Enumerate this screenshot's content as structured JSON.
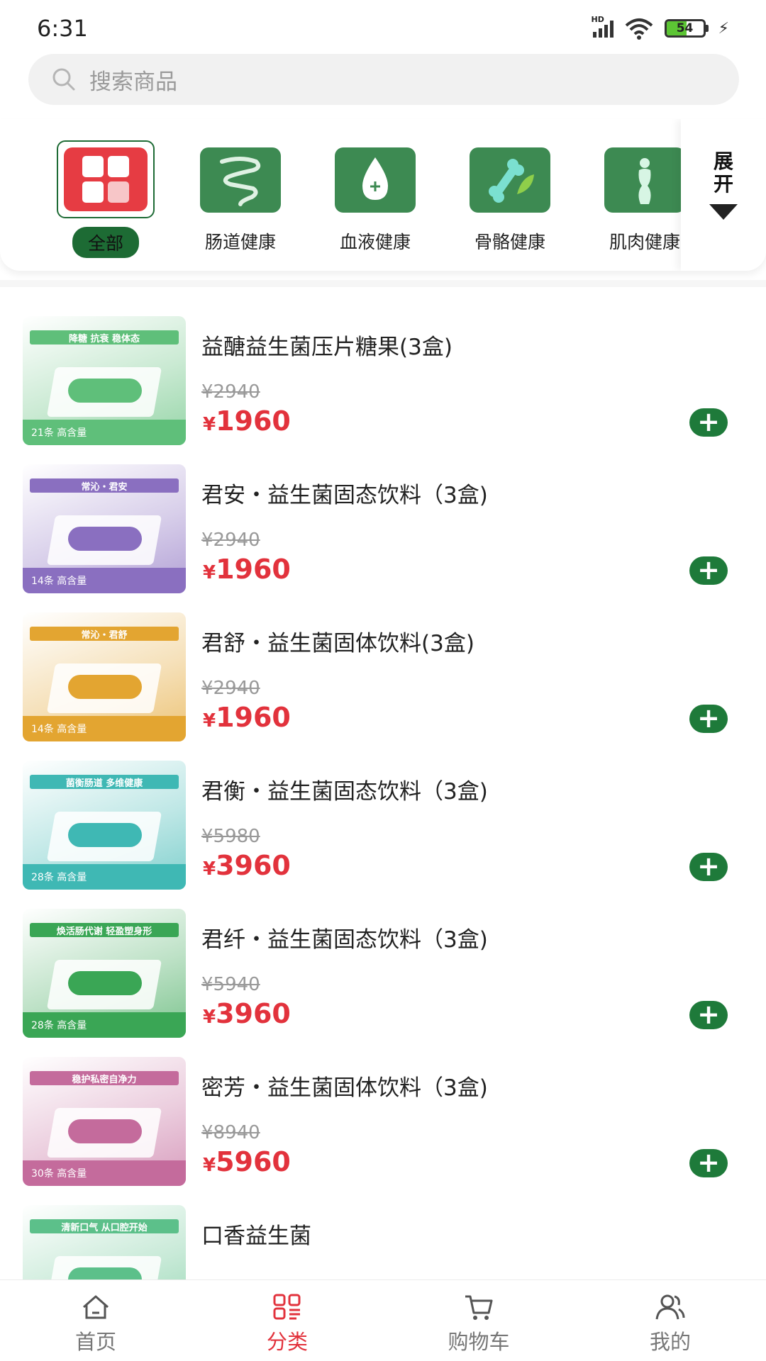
{
  "status_bar": {
    "time": "6:31",
    "network": "HD",
    "battery": "54",
    "battery_level": 0.54
  },
  "search": {
    "placeholder": "搜索商品"
  },
  "categories": {
    "items": [
      {
        "label": "全部",
        "icon": "grid-icon",
        "selected": true
      },
      {
        "label": "肠道健康",
        "icon": "intestine-icon"
      },
      {
        "label": "血液健康",
        "icon": "blood-drop-icon"
      },
      {
        "label": "骨骼健康",
        "icon": "bone-icon"
      },
      {
        "label": "肌肉健康",
        "icon": "body-icon"
      }
    ],
    "expand_label": "展开"
  },
  "products": [
    {
      "name": "益醣益生菌压片糖果(3盒)",
      "old_price": "2940",
      "price": "1960",
      "currency": "¥",
      "thumb": {
        "banner": "降糖 抗衰 稳体态",
        "badge": "21条 高含量",
        "theme": "#5fbf7a"
      }
    },
    {
      "name": "君安・益生菌固态饮料（3盒)",
      "old_price": "2940",
      "price": "1960",
      "currency": "¥",
      "thumb": {
        "banner": "常沁・君安",
        "badge": "14条 高含量",
        "theme": "#8a6fc0"
      }
    },
    {
      "name": "君舒・益生菌固体饮料(3盒)",
      "old_price": "2940",
      "price": "1960",
      "currency": "¥",
      "thumb": {
        "banner": "常沁・君舒",
        "badge": "14条 高含量",
        "theme": "#e3a531"
      }
    },
    {
      "name": "君衡・益生菌固态饮料（3盒)",
      "old_price": "5980",
      "price": "3960",
      "currency": "¥",
      "thumb": {
        "banner": "菌衡肠道 多维健康",
        "badge": "28条 高含量",
        "theme": "#3fb8b4"
      }
    },
    {
      "name": "君纤・益生菌固态饮料（3盒)",
      "old_price": "5940",
      "price": "3960",
      "currency": "¥",
      "thumb": {
        "banner": "焕活肠代谢 轻盈塑身形",
        "badge": "28条 高含量",
        "theme": "#3aa655"
      }
    },
    {
      "name": "密芳・益生菌固体饮料（3盒)",
      "old_price": "8940",
      "price": "5960",
      "currency": "¥",
      "thumb": {
        "banner": "稳护私密自净力",
        "badge": "30条 高含量",
        "theme": "#c46b9c"
      }
    },
    {
      "name": "口香益生菌",
      "old_price": "",
      "price": "",
      "currency": "",
      "thumb": {
        "banner": "清新口气 从口腔开始",
        "badge": "",
        "theme": "#5cc08a"
      }
    }
  ],
  "bottom_nav": [
    {
      "label": "首页",
      "icon": "home-icon"
    },
    {
      "label": "分类",
      "icon": "category-icon",
      "active": true
    },
    {
      "label": "购物车",
      "icon": "cart-icon"
    },
    {
      "label": "我的",
      "icon": "user-icon"
    }
  ],
  "colors": {
    "brand_green": "#1e7a3a",
    "price_red": "#e2323c",
    "active_nav": "#e2323c"
  }
}
